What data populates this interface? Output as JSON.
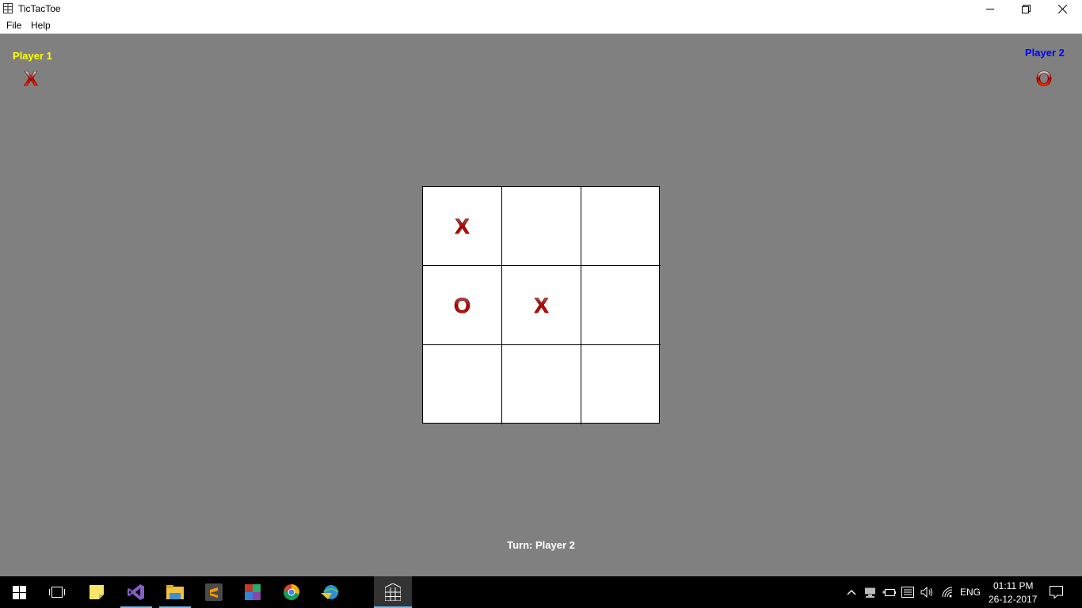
{
  "window": {
    "title": "TicTacToe",
    "icons": {
      "app": "grid-window-icon",
      "minimize": "minimize-icon",
      "restore": "restore-icon",
      "close": "close-icon"
    }
  },
  "menu": {
    "items": [
      "File",
      "Help"
    ]
  },
  "players": {
    "player1": {
      "label": "Player 1",
      "symbol": "X",
      "color": "#ffff00"
    },
    "player2": {
      "label": "Player 2",
      "symbol": "O",
      "color": "#0000ff"
    }
  },
  "board": {
    "cells": [
      [
        "X",
        "",
        ""
      ],
      [
        "O",
        "X",
        ""
      ],
      [
        "",
        "",
        ""
      ]
    ]
  },
  "status": {
    "turn": "Turn: Player 2"
  },
  "taskbar": {
    "apps": [
      "windows-start-icon",
      "task-view-icon",
      "sticky-notes-icon",
      "visual-studio-icon",
      "file-explorer-icon",
      "sublime-text-icon",
      "winrar-icon",
      "chrome-icon",
      "internet-download-manager-icon",
      "tictactoe-app-icon"
    ],
    "tray": {
      "language": "ENG",
      "time": "01:11 PM",
      "date": "26-12-2017",
      "icons": [
        "chevron-up-icon",
        "network-drive-icon",
        "battery-icon",
        "keyboard-icon",
        "volume-icon",
        "wifi-icon",
        "notification-icon"
      ]
    }
  }
}
